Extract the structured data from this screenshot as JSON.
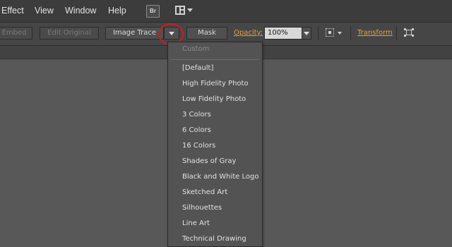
{
  "menubar": {
    "items": [
      "Effect",
      "View",
      "Window",
      "Help"
    ],
    "bridge_label": "Br"
  },
  "controlbar": {
    "embed_label": "Embed",
    "edit_original_label": "Edit Original",
    "image_trace_label": "Image Trace",
    "mask_label": "Mask",
    "opacity_label": "Opacity:",
    "opacity_value": "100%",
    "transform_label": "Transform"
  },
  "dropdown": {
    "header": "Custom",
    "items": [
      "[Default]",
      "High Fidelity Photo",
      "Low Fidelity Photo",
      "3 Colors",
      "6 Colors",
      "16 Colors",
      "Shades of Gray",
      "Black and White Logo",
      "Sketched Art",
      "Silhouettes",
      "Line Art",
      "Technical Drawing"
    ]
  },
  "colors": {
    "accent_link": "#e6a33a",
    "highlight_circle": "#c81e1e",
    "canvas": "#585858"
  },
  "icons": [
    "workspace-switcher-icon",
    "align-icon",
    "isolate-icon",
    "chevron-down-icon"
  ]
}
